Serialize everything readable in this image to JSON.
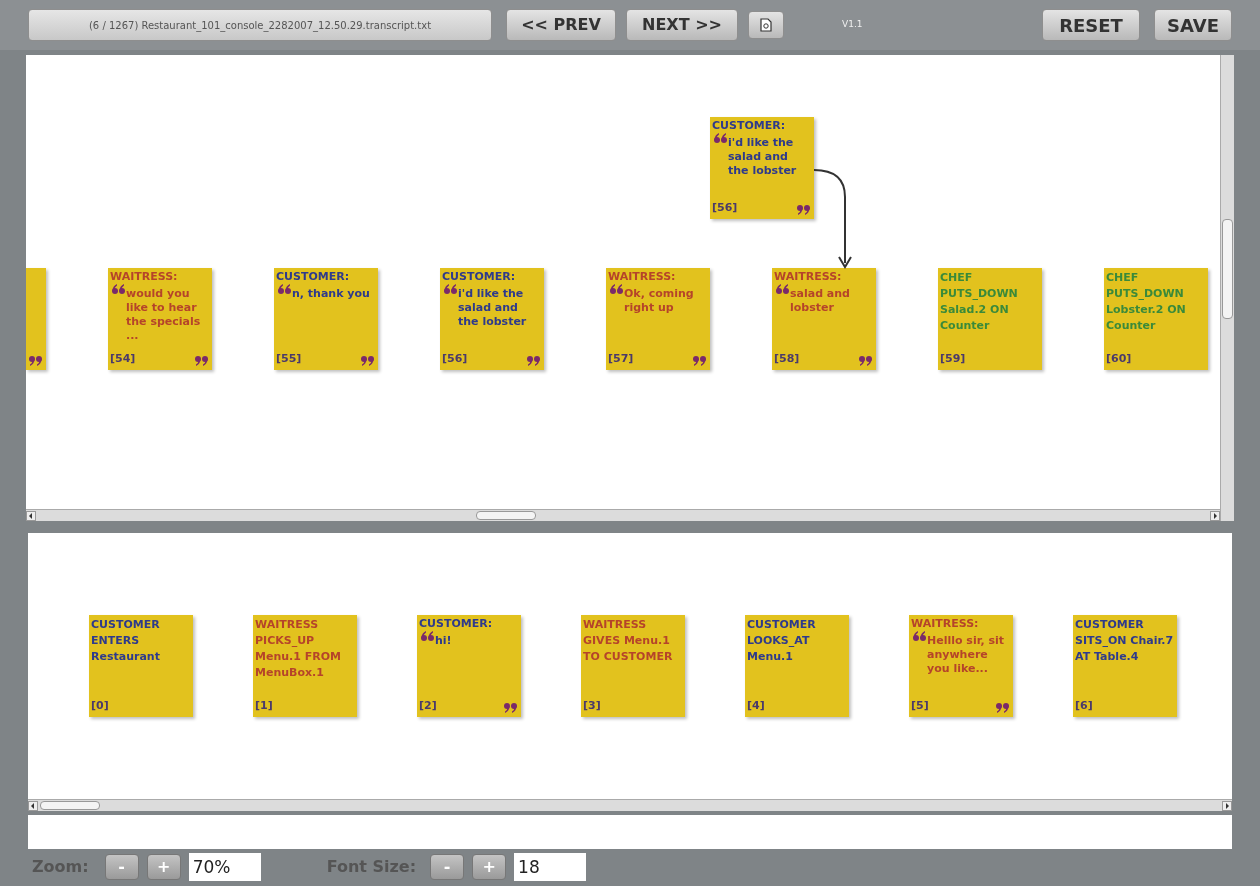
{
  "toolbar": {
    "file_label": "(6 / 1267) Restaurant_101_console_2282007_12.50.29.transcript.txt",
    "prev_button": "<< PREV",
    "next_button": "NEXT >>",
    "version": "V1.1",
    "reset_button": "RESET",
    "save_button": "SAVE"
  },
  "top_timeline": {
    "cards": [
      {
        "kind": "clipped"
      },
      {
        "kind": "utterance",
        "speaker": "WAITRESS:",
        "text": "would you like to hear the specials ...",
        "index": "[54]",
        "color": "#b5442a"
      },
      {
        "kind": "utterance",
        "speaker": "CUSTOMER:",
        "text": "n, thank you",
        "index": "[55]",
        "color": "#2e3a8c"
      },
      {
        "kind": "utterance",
        "speaker": "CUSTOMER:",
        "text": "i'd like the salad and the lobster",
        "index": "[56]",
        "color": "#2e3a8c"
      },
      {
        "kind": "utterance",
        "speaker": "WAITRESS:",
        "text": "Ok, coming right up",
        "index": "[57]",
        "color": "#b5442a"
      },
      {
        "kind": "utterance",
        "speaker": "WAITRESS:",
        "text": "salad and lobster",
        "index": "[58]",
        "color": "#b5442a"
      },
      {
        "kind": "action",
        "text": "CHEF PUTS_DOWN Salad.2 ON Counter",
        "index": "[59]",
        "color": "#3a8a3a"
      },
      {
        "kind": "action",
        "text": "CHEF PUTS_DOWN Lobster.2 ON Counter",
        "index": "[60]",
        "color": "#3a8a3a"
      }
    ],
    "floating_card": {
      "kind": "utterance",
      "speaker": "CUSTOMER:",
      "text": "i'd like the salad and the lobster",
      "index": "[56]",
      "color": "#2e3a8c"
    }
  },
  "bottom_timeline": {
    "cards": [
      {
        "kind": "action",
        "text": "CUSTOMER ENTERS Restaurant",
        "index": "[0]",
        "color": "#2e3a8c"
      },
      {
        "kind": "action",
        "text": "WAITRESS PICKS_UP Menu.1 FROM MenuBox.1",
        "index": "[1]",
        "color": "#b5442a"
      },
      {
        "kind": "utterance",
        "speaker": "CUSTOMER:",
        "text": "hi!",
        "index": "[2]",
        "color": "#2e3a8c"
      },
      {
        "kind": "action",
        "text": "WAITRESS GIVES Menu.1 TO CUSTOMER",
        "index": "[3]",
        "color": "#b5442a"
      },
      {
        "kind": "action",
        "text": "CUSTOMER LOOKS_AT Menu.1",
        "index": "[4]",
        "color": "#2e3a8c"
      },
      {
        "kind": "utterance",
        "speaker": "WAITRESS:",
        "text": "Helllo sir, sit anywhere you like...",
        "index": "[5]",
        "color": "#b5442a"
      },
      {
        "kind": "action",
        "text": "CUSTOMER SITS_ON Chair.7 AT Table.4",
        "index": "[6]",
        "color": "#2e3a8c"
      }
    ]
  },
  "footer": {
    "zoom_label": "Zoom:",
    "zoom_minus": "-",
    "zoom_plus": "+",
    "zoom_value": "70%",
    "font_label": "Font Size:",
    "font_minus": "-",
    "font_plus": "+",
    "font_value": "18"
  }
}
